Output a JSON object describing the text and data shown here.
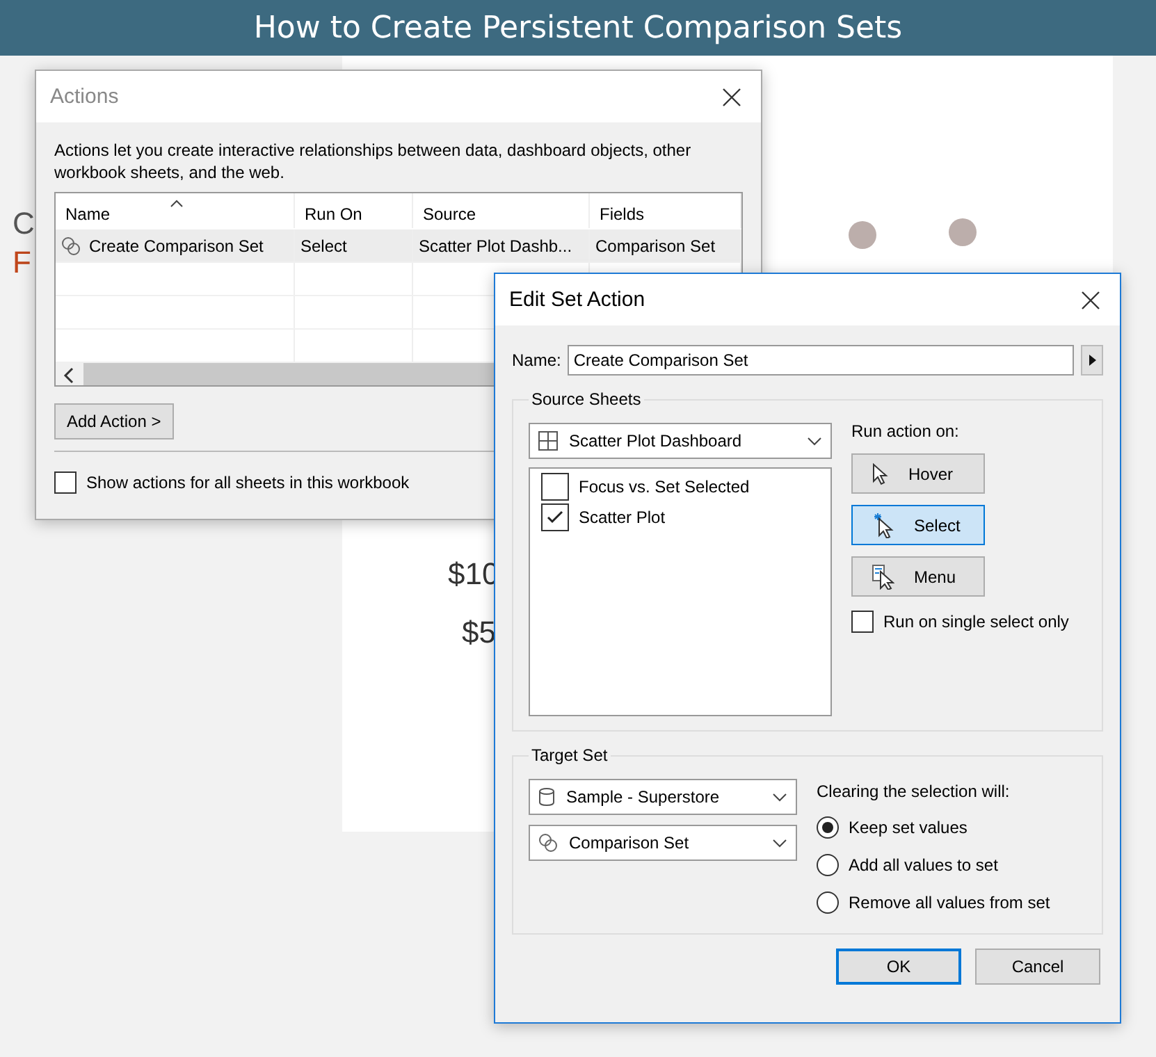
{
  "page": {
    "title": "How to Create Persistent Comparison Sets",
    "left_texts": [
      {
        "text": "C",
        "color": "#555555"
      },
      {
        "text": "F",
        "color": "#c0461b"
      }
    ],
    "chart_texts": [
      "$10",
      "$5"
    ]
  },
  "actions_dialog": {
    "title": "Actions",
    "description": "Actions let you create interactive relationships between data, dashboard objects, other workbook sheets, and the web.",
    "table": {
      "columns": [
        "Name",
        "Run On",
        "Source",
        "Fields"
      ],
      "rows": [
        {
          "cells": [
            "Create Comparison Set",
            "Select",
            "Scatter Plot Dashb...",
            "Comparison Set"
          ],
          "selected": true
        }
      ]
    },
    "add_button": "Add Action >",
    "show_all": {
      "label": "Show actions for all sheets in this workbook",
      "checked": false
    }
  },
  "edit_dialog": {
    "title": "Edit Set Action",
    "name_label": "Name:",
    "name_value": "Create Comparison Set",
    "source_sheets": {
      "legend": "Source Sheets",
      "dropdown": "Scatter Plot Dashboard",
      "sheets": [
        {
          "label": "Focus vs. Set Selected",
          "checked": false
        },
        {
          "label": "Scatter Plot",
          "checked": true
        }
      ],
      "run_label": "Run action on:",
      "run_options": [
        {
          "label": "Hover",
          "kind": "hover",
          "selected": false
        },
        {
          "label": "Select",
          "kind": "select",
          "selected": true
        },
        {
          "label": "Menu",
          "kind": "menu",
          "selected": false
        }
      ],
      "single_select": {
        "label": "Run on single select only",
        "checked": false
      }
    },
    "target_set": {
      "legend": "Target Set",
      "datasource": "Sample - Superstore",
      "set": "Comparison Set",
      "clearing_label": "Clearing the selection will:",
      "options": [
        {
          "label": "Keep set values",
          "selected": true
        },
        {
          "label": "Add all values to set",
          "selected": false
        },
        {
          "label": "Remove all values from set",
          "selected": false
        }
      ]
    },
    "buttons": [
      {
        "label": "OK",
        "default": true
      },
      {
        "label": "Cancel",
        "default": false
      }
    ]
  }
}
